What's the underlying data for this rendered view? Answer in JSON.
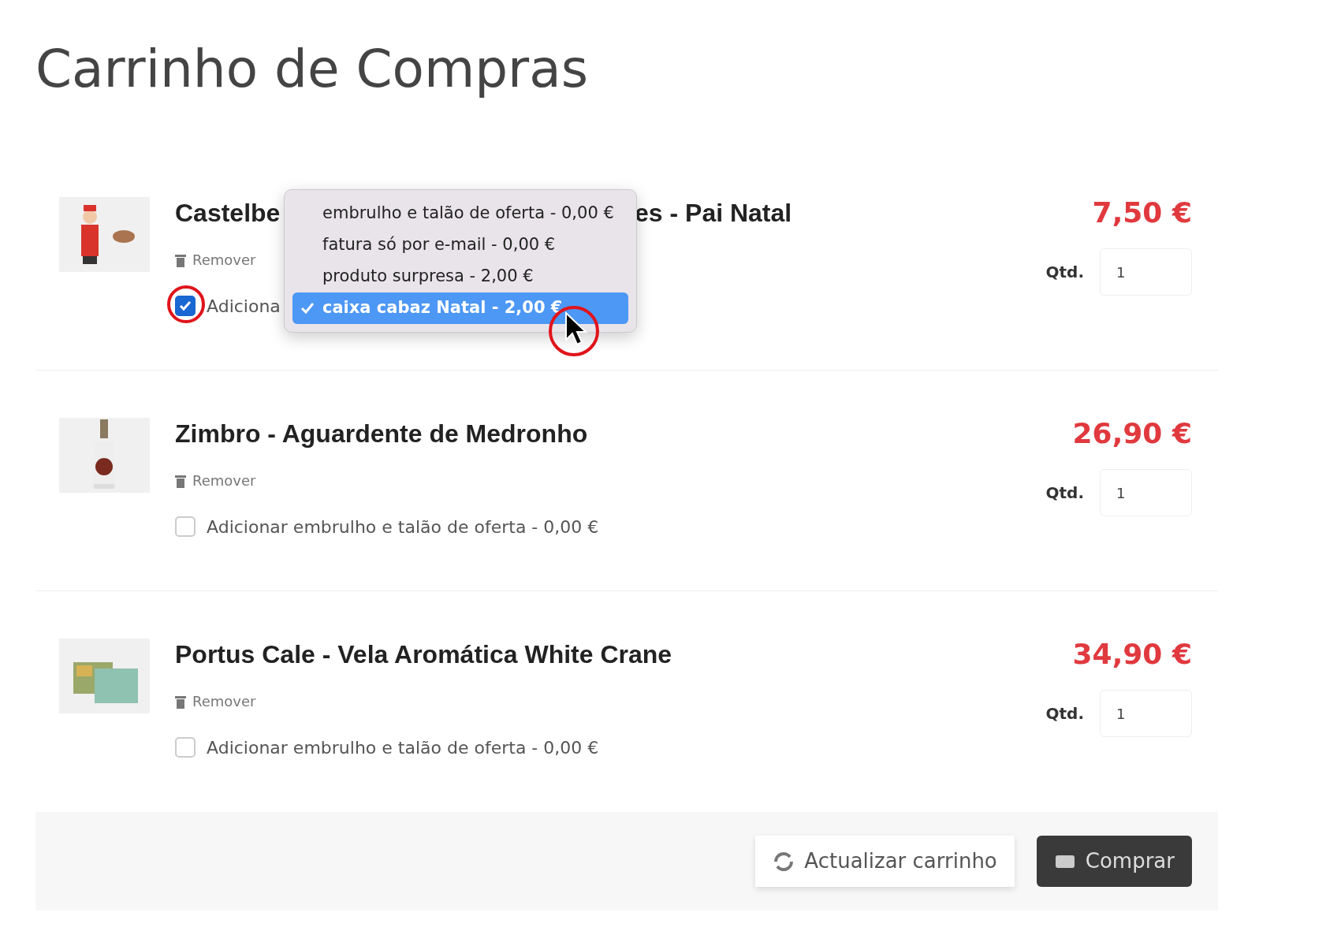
{
  "page_title": "Carrinho de Compras",
  "items": [
    {
      "title_parts": [
        "Castelbe",
        "es - Pai Natal"
      ],
      "remove": "Remover",
      "gift": {
        "label": "Adiciona",
        "checked": true
      },
      "price": "7,50 €",
      "qty_label": "Qtd.",
      "qty": "1"
    },
    {
      "title_parts": [
        "Zimbro - Aguardente de Medronho"
      ],
      "remove": "Remover",
      "gift": {
        "label": "Adicionar embrulho e talão de oferta - 0,00 €",
        "checked": false
      },
      "price": "26,90 €",
      "qty_label": "Qtd.",
      "qty": "1"
    },
    {
      "title_parts": [
        "Portus Cale - Vela Aromática White Crane"
      ],
      "remove": "Remover",
      "gift": {
        "label": "Adicionar embrulho e talão de oferta - 0,00 €",
        "checked": false
      },
      "price": "34,90 €",
      "qty_label": "Qtd.",
      "qty": "1"
    }
  ],
  "dropdown": {
    "options": [
      {
        "label": "embrulho e talão de oferta - 0,00 €",
        "selected": false
      },
      {
        "label": "fatura só por e-mail - 0,00 €",
        "selected": false
      },
      {
        "label": "produto surpresa - 2,00 €",
        "selected": false
      },
      {
        "label": "caixa cabaz Natal - 2,00 €",
        "selected": true
      }
    ]
  },
  "buttons": [
    {
      "label": "Actualizar carrinho",
      "kind": "secondary"
    },
    {
      "label": "Comprar",
      "kind": "primary"
    }
  ]
}
